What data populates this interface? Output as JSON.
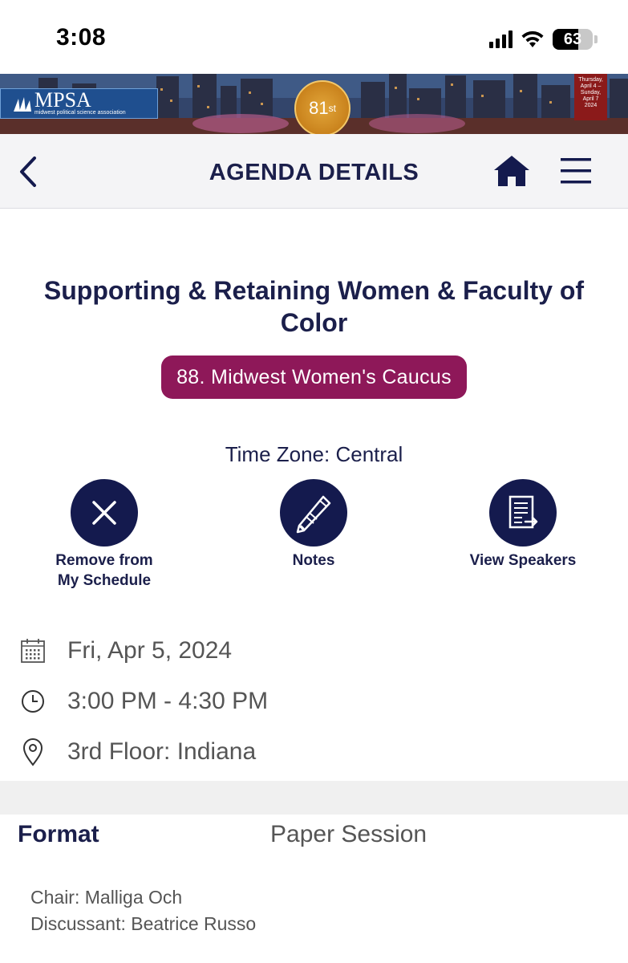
{
  "status_bar": {
    "time": "3:08",
    "battery_level": "63",
    "battery_fraction": 0.63
  },
  "banner": {
    "logo_name": "MPSA",
    "logo_subtitle": "midwest political science association",
    "seal_number": "81",
    "seal_suffix": "st",
    "date_badge_lines": [
      "Thursday,",
      "April 4 –",
      "Sunday,",
      "April 7",
      "2024"
    ]
  },
  "nav": {
    "title": "AGENDA DETAILS",
    "back_icon": "chevron-left-icon",
    "home_icon": "home-icon",
    "menu_icon": "hamburger-menu-icon"
  },
  "session": {
    "title": "Supporting & Retaining Women & Faculty of Color",
    "track": "88. Midwest Women's Caucus",
    "time_zone": "Time Zone: Central"
  },
  "actions": {
    "remove_label": "Remove from\nMy Schedule",
    "remove_line1": "Remove from",
    "remove_line2": "My Schedule",
    "notes_label": "Notes",
    "speakers_label": "View Speakers"
  },
  "details": {
    "date": "Fri, Apr 5, 2024",
    "time": "3:00 PM - 4:30 PM",
    "location": "3rd Floor: Indiana"
  },
  "format": {
    "label": "Format",
    "value": "Paper Session"
  },
  "people": {
    "chair": "Chair: Malliga Och",
    "discussant": "Discussant: Beatrice Russo"
  },
  "colors": {
    "navy": "#141a4e",
    "title_navy": "#1b1f4b",
    "track_badge": "#8e1859",
    "detail_gray": "#555555"
  }
}
